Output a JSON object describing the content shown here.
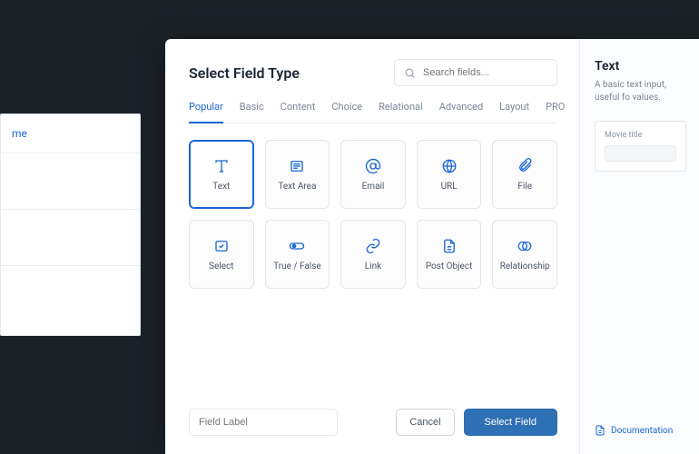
{
  "bg": {
    "header": "me"
  },
  "title": "Select Field Type",
  "search": {
    "placeholder": "Search fields..."
  },
  "tabs": [
    "Popular",
    "Basic",
    "Content",
    "Choice",
    "Relational",
    "Advanced",
    "Layout",
    "PRO"
  ],
  "active_tab": 0,
  "fields": [
    {
      "label": "Text",
      "icon": "text",
      "selected": true
    },
    {
      "label": "Text Area",
      "icon": "textarea",
      "selected": false
    },
    {
      "label": "Email",
      "icon": "email",
      "selected": false
    },
    {
      "label": "URL",
      "icon": "url",
      "selected": false
    },
    {
      "label": "File",
      "icon": "file",
      "selected": false
    },
    {
      "label": "Select",
      "icon": "select",
      "selected": false
    },
    {
      "label": "True / False",
      "icon": "toggle",
      "selected": false
    },
    {
      "label": "Link",
      "icon": "link",
      "selected": false
    },
    {
      "label": "Post Object",
      "icon": "post",
      "selected": false
    },
    {
      "label": "Relationship",
      "icon": "relation",
      "selected": false
    }
  ],
  "field_label_placeholder": "Field Label",
  "buttons": {
    "cancel": "Cancel",
    "select": "Select Field"
  },
  "side": {
    "title": "Text",
    "desc": "A basic text input, useful fo values.",
    "preview_label": "Movie title",
    "doc": "Documentation"
  }
}
